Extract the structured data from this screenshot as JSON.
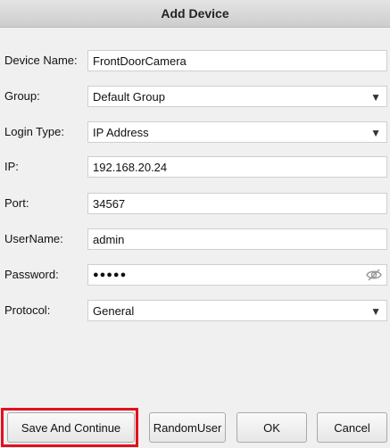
{
  "dialog": {
    "title": "Add Device"
  },
  "form": {
    "device_name": {
      "label": "Device Name:",
      "value": "FrontDoorCamera"
    },
    "group": {
      "label": "Group:",
      "value": "Default Group"
    },
    "login_type": {
      "label": "Login Type:",
      "value": "IP Address"
    },
    "ip": {
      "label": "IP:",
      "value": "192.168.20.24"
    },
    "port": {
      "label": "Port:",
      "value": "34567"
    },
    "username": {
      "label": "UserName:",
      "value": "admin"
    },
    "password": {
      "label": "Password:",
      "value": "●●●●●"
    },
    "protocol": {
      "label": "Protocol:",
      "value": "General"
    }
  },
  "buttons": {
    "save_continue": "Save And Continue",
    "random_user": "RandomUser",
    "ok": "OK",
    "cancel": "Cancel"
  },
  "icons": {
    "dropdown": "▼",
    "password_toggle": "eye-slash-icon"
  },
  "colors": {
    "highlight": "#e3101e"
  }
}
